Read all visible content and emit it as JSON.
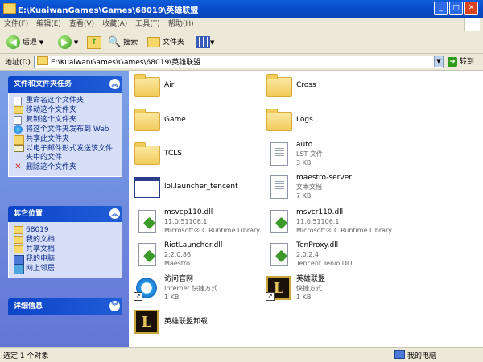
{
  "window": {
    "title": "E:\\KuaiwanGames\\Games\\68019\\英雄联盟"
  },
  "menu": [
    "文件(F)",
    "编辑(E)",
    "查看(V)",
    "收藏(A)",
    "工具(T)",
    "帮助(H)"
  ],
  "toolbar": {
    "back": "后退",
    "search": "搜索",
    "folders": "文件夹"
  },
  "address": {
    "label": "地址(D)",
    "value": "E:\\KuaiwanGames\\Games\\68019\\英雄联盟",
    "go": "转到"
  },
  "left": {
    "tasks": {
      "title": "文件和文件夹任务",
      "items": [
        "重命名这个文件夹",
        "移动这个文件夹",
        "复制这个文件夹",
        "将这个文件夹发布到 Web",
        "共享此文件夹",
        "以电子邮件形式发送该文件夹中的文件",
        "删除这个文件夹"
      ]
    },
    "places": {
      "title": "其它位置",
      "items": [
        "68019",
        "我的文档",
        "共享文档",
        "我的电脑",
        "网上邻居"
      ]
    },
    "details": {
      "title": "详细信息"
    }
  },
  "items": [
    {
      "name": "Air"
    },
    {
      "name": "Cross"
    },
    {
      "name": "Game"
    },
    {
      "name": "Logs"
    },
    {
      "name": "TCLS"
    },
    {
      "name": "auto",
      "l1": "LST 文件",
      "l2": "3 KB"
    },
    {
      "name": "lol.launcher_tencent"
    },
    {
      "name": "maestro-server",
      "l1": "文本文档",
      "l2": "7 KB"
    },
    {
      "name": "msvcp110.dll",
      "l1": "11.0.51106.1",
      "l2": "Microsoft® C Runtime Library"
    },
    {
      "name": "msvcr110.dll",
      "l1": "11.0.51106.1",
      "l2": "Microsoft® C Runtime Library"
    },
    {
      "name": "RiotLauncher.dll",
      "l1": "2.2.0.86",
      "l2": "Maestro"
    },
    {
      "name": "TenProxy.dll",
      "l1": "2.0.2.4",
      "l2": "Tencent Tenio DLL"
    },
    {
      "name": "访问官网",
      "l1": "Internet 快捷方式",
      "l2": "1 KB"
    },
    {
      "name": "英雄联盟",
      "l1": "快捷方式",
      "l2": "1 KB"
    },
    {
      "name": "英雄联盟卸载"
    }
  ],
  "status": {
    "left": "选定 1 个对象",
    "right": "我的电脑"
  }
}
